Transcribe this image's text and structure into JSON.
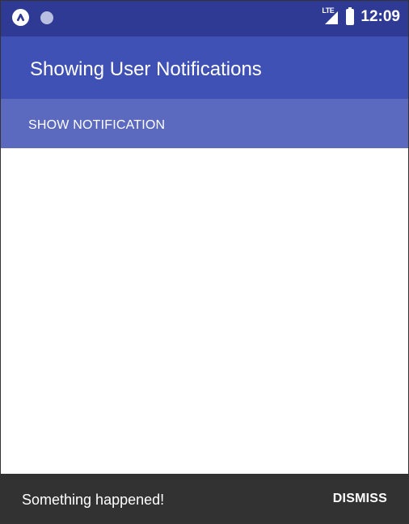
{
  "status_bar": {
    "time": "12:09",
    "network_label": "LTE",
    "left_icons": [
      "app-a-icon",
      "notification-dot-icon"
    ],
    "right_icons": [
      "signal-icon",
      "battery-icon"
    ]
  },
  "toolbar": {
    "title": "Showing User Notifications"
  },
  "main": {
    "show_button_label": "SHOW NOTIFICATION"
  },
  "snackbar": {
    "message": "Something happened!",
    "action_label": "DISMISS"
  },
  "colors": {
    "status_bar": "#2f3a95",
    "primary": "#3f51b5",
    "button": "#5b6abf",
    "snackbar": "#323232",
    "text_on_primary": "#ffffff"
  }
}
